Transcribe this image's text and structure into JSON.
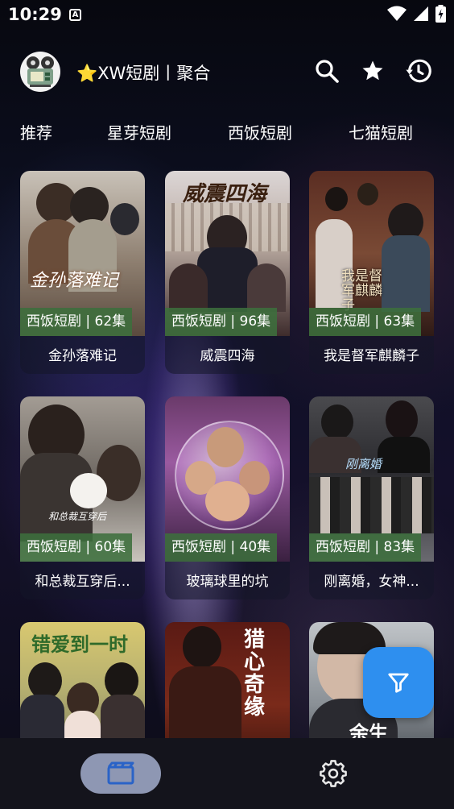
{
  "status_bar": {
    "time": "10:29",
    "notification_icon": "A"
  },
  "header": {
    "title": "⭐XW短剧丨聚合",
    "icons": [
      "search-icon",
      "star-icon",
      "history-icon"
    ]
  },
  "tabs": [
    {
      "label": "推荐"
    },
    {
      "label": "星芽短剧"
    },
    {
      "label": "西饭短剧"
    },
    {
      "label": "七猫短剧"
    }
  ],
  "dramas": [
    {
      "badge": "西饭短剧 | 62集",
      "title": "金孙落难记",
      "poster_text": "金孙落难记"
    },
    {
      "badge": "西饭短剧 | 96集",
      "title": "威震四海",
      "poster_text": "威震四海"
    },
    {
      "badge": "西饭短剧 | 63集",
      "title": "我是督军麒麟子",
      "poster_text": "我是督军麒麟子"
    },
    {
      "badge": "西饭短剧 | 60集",
      "title": "和总裁互穿后...",
      "poster_text": "和总裁互穿后"
    },
    {
      "badge": "西饭短剧 | 40集",
      "title": "玻璃球里的坑",
      "poster_text": ""
    },
    {
      "badge": "西饭短剧 | 83集",
      "title": "刚离婚，女神...",
      "poster_text": "刚离婚"
    },
    {
      "badge": "",
      "title": "",
      "poster_text": "错爱到一时"
    },
    {
      "badge": "",
      "title": "",
      "poster_text": "猎心奇缘"
    },
    {
      "badge": "",
      "title": "",
      "poster_text": "余生"
    }
  ],
  "fab": {
    "icon": "filter-icon"
  },
  "bottom_nav": {
    "items": [
      "film-icon",
      "gear-icon"
    ]
  }
}
